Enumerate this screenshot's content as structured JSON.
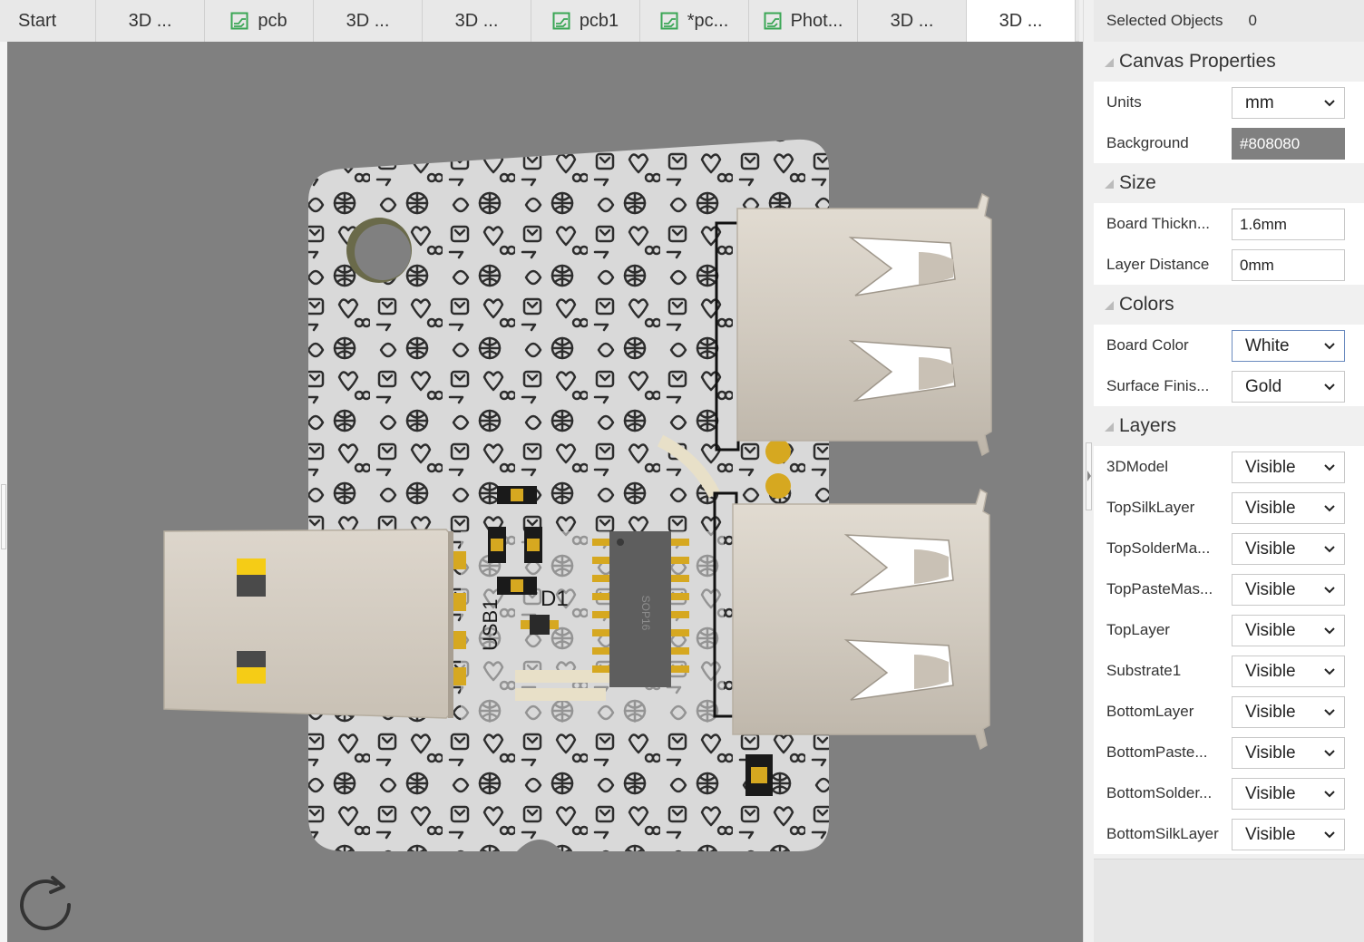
{
  "tabs": [
    {
      "label": "Start",
      "icon": "none",
      "active": false
    },
    {
      "label": "3D ...",
      "icon": "none",
      "active": false
    },
    {
      "label": "pcb",
      "icon": "pcb-document-icon",
      "active": false
    },
    {
      "label": "3D ...",
      "icon": "none",
      "active": false
    },
    {
      "label": "3D ...",
      "icon": "none",
      "active": false
    },
    {
      "label": "pcb1",
      "icon": "pcb-document-icon",
      "active": false
    },
    {
      "label": "*pc...",
      "icon": "pcb-document-icon",
      "active": false
    },
    {
      "label": "Phot...",
      "icon": "pcb-document-icon",
      "active": false
    },
    {
      "label": "3D ...",
      "icon": "none",
      "active": false
    },
    {
      "label": "3D ...",
      "icon": "none",
      "active": true
    }
  ],
  "panel": {
    "selected_label": "Selected Objects",
    "selected_value": "0",
    "canvas": {
      "title": "Canvas Properties",
      "units_label": "Units",
      "units_value": "mm",
      "background_label": "Background",
      "background_value": "#808080"
    },
    "size": {
      "title": "Size",
      "thickness_label": "Board Thickn...",
      "thickness_value": "1.6mm",
      "layer_distance_label": "Layer Distance",
      "layer_distance_value": "0mm"
    },
    "colors": {
      "title": "Colors",
      "board_color_label": "Board Color",
      "board_color_value": "White",
      "surface_label": "Surface Finis...",
      "surface_value": "Gold"
    },
    "layers": {
      "title": "Layers",
      "items": [
        {
          "label": "3DModel",
          "value": "Visible"
        },
        {
          "label": "TopSilkLayer",
          "value": "Visible"
        },
        {
          "label": "TopSolderMa...",
          "value": "Visible"
        },
        {
          "label": "TopPasteMas...",
          "value": "Visible"
        },
        {
          "label": "TopLayer",
          "value": "Visible"
        },
        {
          "label": "Substrate1",
          "value": "Visible"
        },
        {
          "label": "BottomLayer",
          "value": "Visible"
        },
        {
          "label": "BottomPaste...",
          "value": "Visible"
        },
        {
          "label": "BottomSolder...",
          "value": "Visible"
        },
        {
          "label": "BottomSilkLayer",
          "value": "Visible"
        }
      ]
    }
  },
  "board": {
    "chip_label": "SOP16",
    "designator_d1": "D1",
    "designator_usb": "USB1"
  },
  "colors": {
    "canvas": "#808080",
    "board": "#d9d9d9",
    "gold": "#d6a820",
    "metal": "#d4cdc3",
    "tab_icon": "#3aa655"
  }
}
